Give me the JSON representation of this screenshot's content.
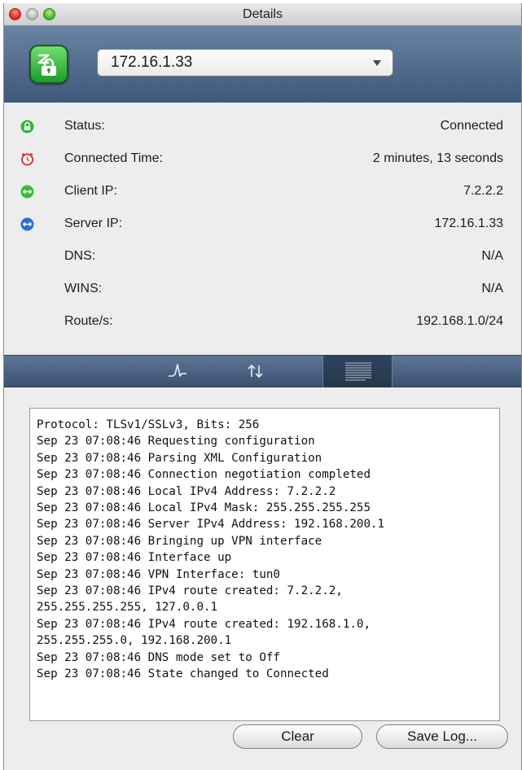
{
  "window": {
    "title": "Details"
  },
  "header": {
    "server_selected": "172.16.1.33"
  },
  "details": [
    {
      "icon": "lock-icon",
      "label": "Status:",
      "value": "Connected",
      "color": "#2db93a"
    },
    {
      "icon": "clock-icon",
      "label": "Connected Time:",
      "value": "2 minutes, 13 seconds",
      "color": "#d7322b"
    },
    {
      "icon": "client-arrows-icon",
      "label": "Client IP:",
      "value": "7.2.2.2",
      "color": "#3dbb3a"
    },
    {
      "icon": "server-arrows-icon",
      "label": "Server IP:",
      "value": "172.16.1.33",
      "color": "#2f6fd6"
    },
    {
      "icon": "",
      "label": "DNS:",
      "value": "N/A"
    },
    {
      "icon": "",
      "label": "WINS:",
      "value": "N/A"
    },
    {
      "icon": "",
      "label": "Route/s:",
      "value": "192.168.1.0/24"
    }
  ],
  "tabs": [
    {
      "name": "graph-tab",
      "icon": "graph-icon"
    },
    {
      "name": "traffic-tab",
      "icon": "up-down-arrows-icon"
    },
    {
      "name": "log-tab",
      "icon": "log-lines-icon",
      "selected": true
    }
  ],
  "log": {
    "lines": [
      "Protocol: TLSv1/SSLv3, Bits: 256",
      "Sep 23 07:08:46 Requesting configuration",
      "Sep 23 07:08:46 Parsing XML Configuration",
      "Sep 23 07:08:46 Connection negotiation completed",
      "Sep 23 07:08:46 Local IPv4 Address: 7.2.2.2",
      "Sep 23 07:08:46 Local IPv4 Mask: 255.255.255.255",
      "Sep 23 07:08:46 Server IPv4 Address: 192.168.200.1",
      "Sep 23 07:08:46 Bringing up VPN interface",
      "Sep 23 07:08:46 Interface up",
      "Sep 23 07:08:46 VPN Interface: tun0",
      "Sep 23 07:08:46 IPv4 route created: 7.2.2.2,",
      "255.255.255.255, 127.0.0.1",
      "Sep 23 07:08:46 IPv4 route created: 192.168.1.0,",
      "255.255.255.0, 192.168.200.1",
      "Sep 23 07:08:46 DNS mode set to Off",
      "Sep 23 07:08:46 State changed to Connected"
    ]
  },
  "buttons": {
    "clear": "Clear",
    "save_log": "Save Log..."
  }
}
